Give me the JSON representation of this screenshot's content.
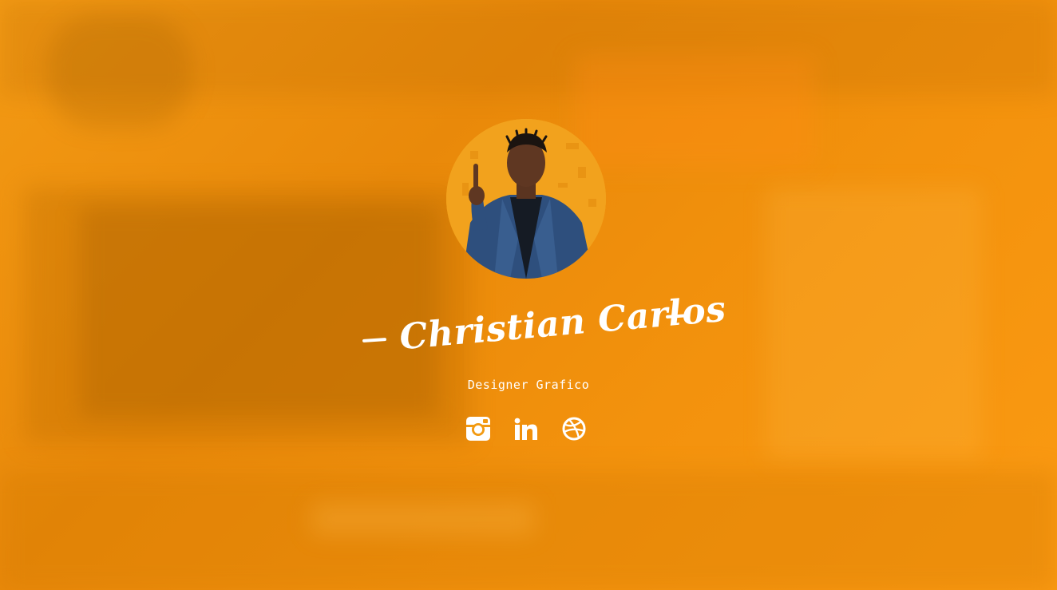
{
  "profile": {
    "name": "Christian Carlos",
    "role": "Designer Grafico"
  },
  "social": [
    {
      "name": "instagram-icon",
      "label": "Instagram"
    },
    {
      "name": "linkedin-icon",
      "label": "LinkedIn"
    },
    {
      "name": "dribbble-icon",
      "label": "Dribbble"
    }
  ],
  "colors": {
    "background": "#f08f0b",
    "text": "#ffffff",
    "avatar_bg": "#f2a21d"
  }
}
